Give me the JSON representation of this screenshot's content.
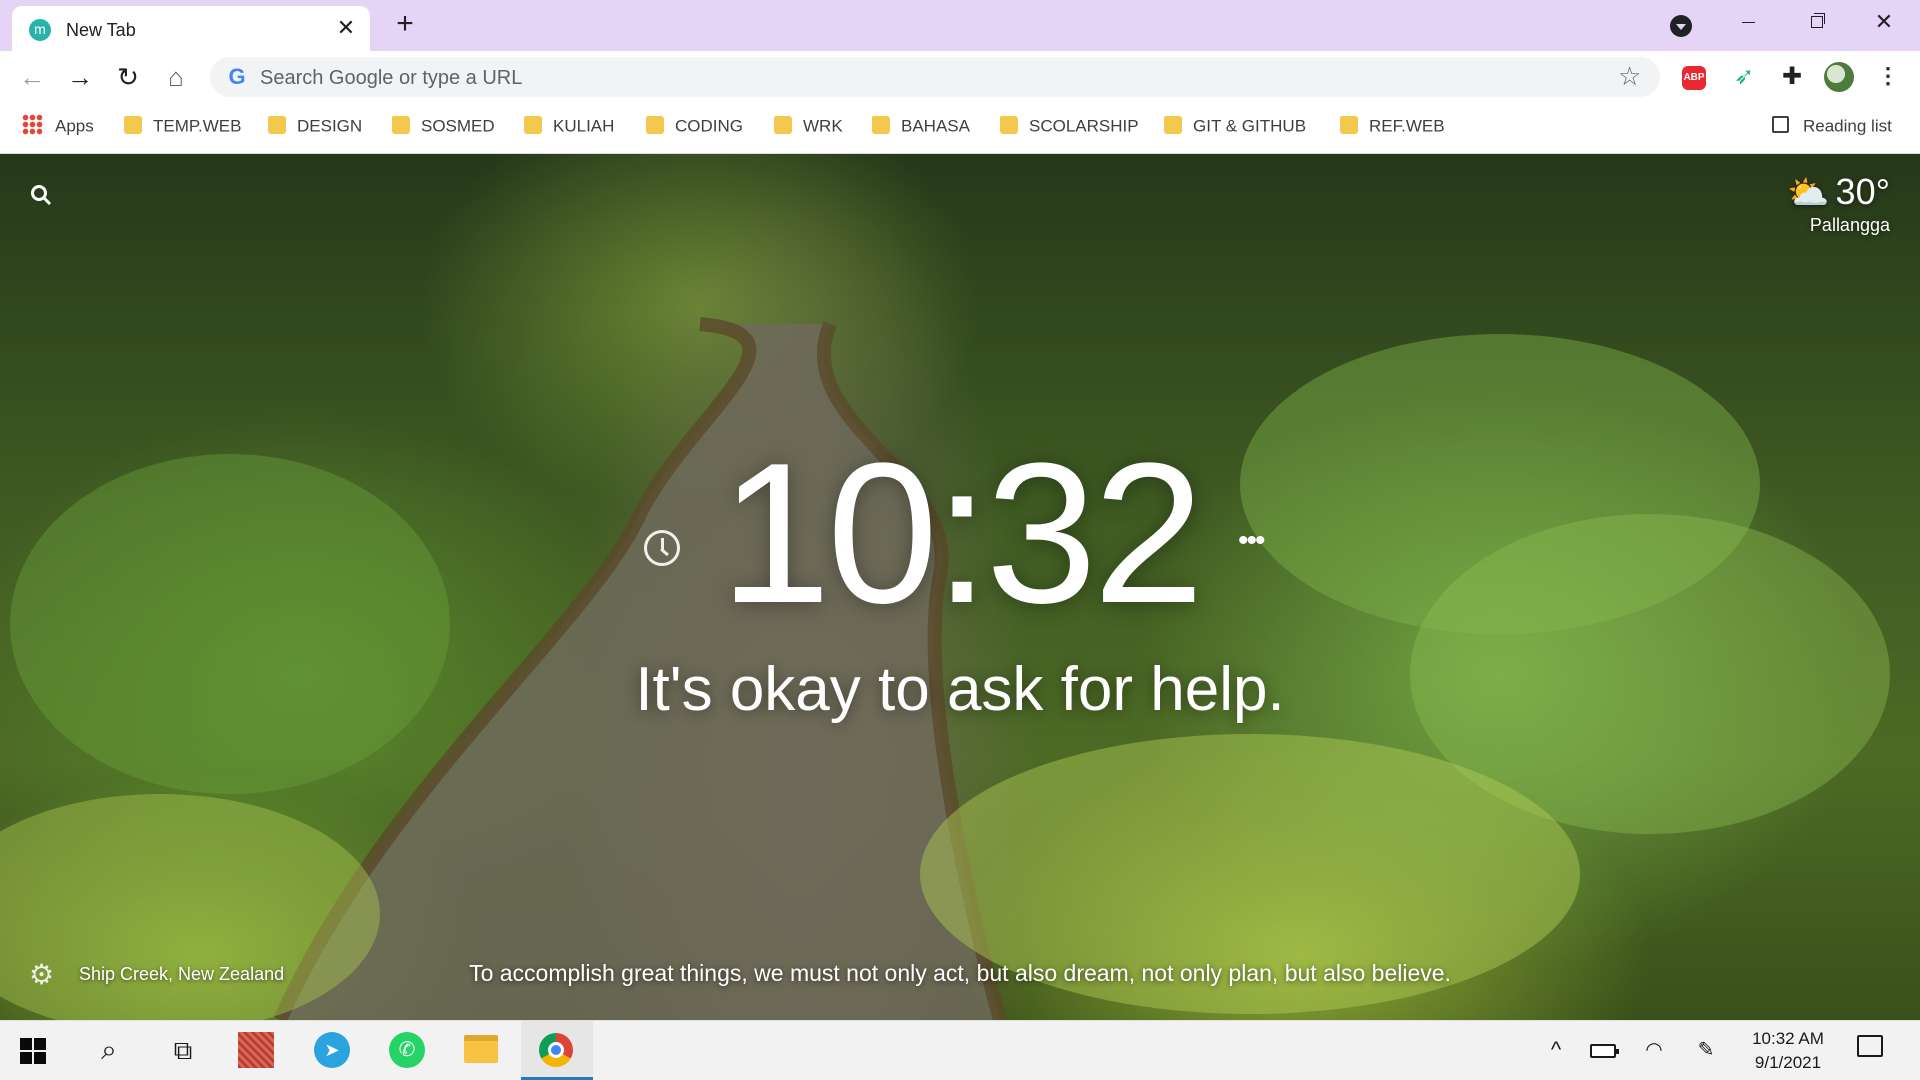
{
  "browser": {
    "tab": {
      "favicon_letter": "m",
      "title": "New Tab",
      "close": "✕"
    },
    "new_tab": "+",
    "window_controls": {
      "close": "✕"
    }
  },
  "toolbar": {
    "back": "←",
    "forward": "→",
    "reload": "↻",
    "home": "⌂",
    "omnibox_placeholder": "Search Google or type a URL",
    "google_icon": "G",
    "bookmark_star": "☆",
    "extensions": {
      "abp_label": "ABP",
      "puzzle": "✚",
      "bird": "➶",
      "menu": "⋮"
    }
  },
  "bookmarks": {
    "apps": "Apps",
    "items": [
      "TEMP.WEB",
      "DESIGN",
      "SOSMED",
      "KULIAH",
      "CODING",
      "WRK",
      "BAHASA",
      "SCOLARSHIP",
      "GIT & GITHUB",
      "REF.WEB"
    ],
    "reading_list": "Reading list"
  },
  "momentum": {
    "weather": {
      "icon": "⛅",
      "temperature": "30°",
      "location": "Pallangga"
    },
    "time": "10:32",
    "more": "•••",
    "mantra": "It's okay to ask for help.",
    "photo_location": "Ship Creek, New Zealand",
    "quote": "To accomplish great things, we must not only act, but also dream, not only plan, but also believe.",
    "settings_icon": "⚙"
  },
  "taskbar": {
    "search_glyph": "⌕",
    "taskview_glyph": "⧉",
    "telegram_glyph": "➤",
    "whatsapp_glyph": "✆",
    "tray_up": "^",
    "wifi_glyph": "◠",
    "pen_glyph": "✎",
    "time": "10:32 AM",
    "date": "9/1/2021"
  },
  "colors": {
    "tabstrip": "#e6d4f7",
    "folder": "#f2c94c",
    "momentum_text": "#ffffff",
    "chrome_active_indicator": "#2a7ab8"
  }
}
